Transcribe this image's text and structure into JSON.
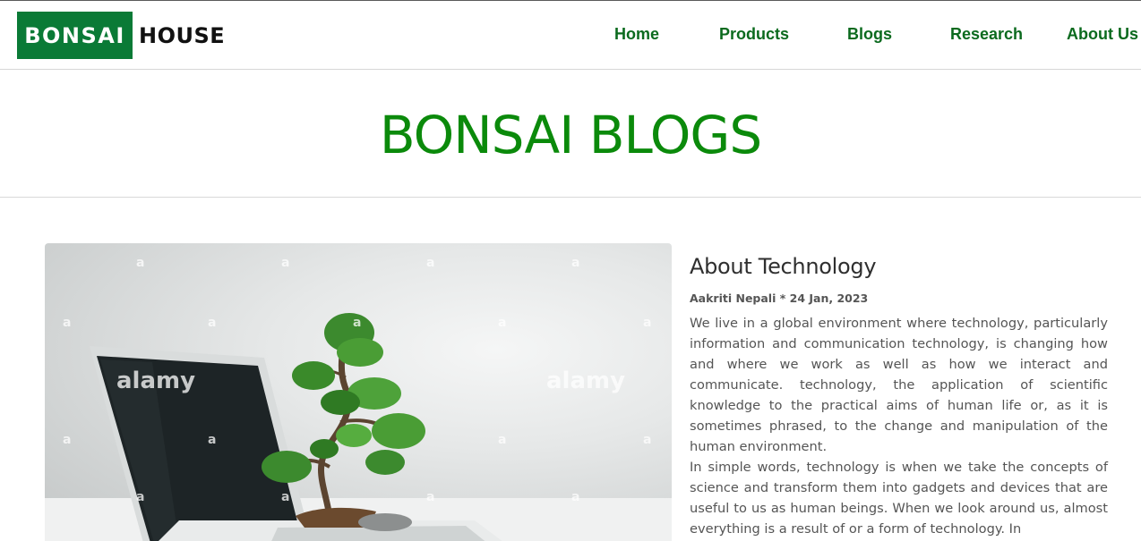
{
  "header": {
    "logo_box": "BONSAI",
    "logo_text": "HOUSE",
    "nav": [
      "Home",
      "Products",
      "Blogs",
      "Research",
      "About Us"
    ]
  },
  "hero": {
    "title": "BONSAI BLOGS"
  },
  "image": {
    "watermark_small": "a",
    "watermark_large": "alamy"
  },
  "article": {
    "title": "About Technology",
    "meta": "Aakriti Nepali * 24 Jan, 2023",
    "paragraphs": [
      "We live in a global environment where technology, particularly information and communication technology, is changing how and where we work as well as how we interact and communicate. technology, the application of scientific knowledge to the practical aims of human life or, as it is sometimes phrased, to the change and manipulation of the human environment.",
      "In simple words, technology is when we take the concepts of science and transform them into gadgets and devices that are useful to us as human beings. When we look around us, almost everything is a result of or a form of technology. In"
    ]
  },
  "colors": {
    "brand_green": "#0a7a36",
    "nav_green": "#0b6a1e",
    "title_green": "#0b8a0b",
    "text_gray": "#555555"
  }
}
